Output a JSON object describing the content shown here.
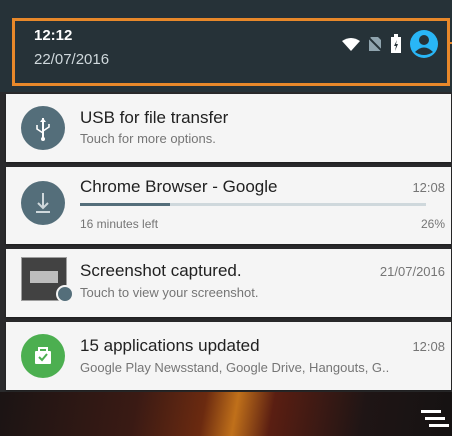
{
  "status_bar": {
    "time": "12:12",
    "date": "22/07/2016",
    "icons": [
      "wifi-icon",
      "no-sim-icon",
      "battery-icon",
      "user-avatar-icon"
    ],
    "accent_color": "#29b6f6",
    "highlight_color": "#e8882a"
  },
  "notifications": [
    {
      "title": "USB for file transfer",
      "text": "Touch for more options.",
      "icon": "usb-icon",
      "icon_color": "#546e7a"
    },
    {
      "title": "Chrome Browser - Google",
      "time": "12:08",
      "text": "16 minutes left",
      "progress_label": "26%",
      "progress": 0.26,
      "icon": "download-icon",
      "icon_color": "#546e7a"
    },
    {
      "title": "Screenshot captured.",
      "time": "21/07/2016",
      "text": "Touch to view your screenshot.",
      "icon": "screenshot-thumbnail"
    },
    {
      "title": "15 applications updated",
      "time": "12:08",
      "text": "Google Play Newsstand, Google Drive, Hangouts, G..",
      "icon": "play-store-update-icon",
      "icon_color": "#4caf50"
    }
  ],
  "quick_settings_icon": "quick-settings-icon"
}
